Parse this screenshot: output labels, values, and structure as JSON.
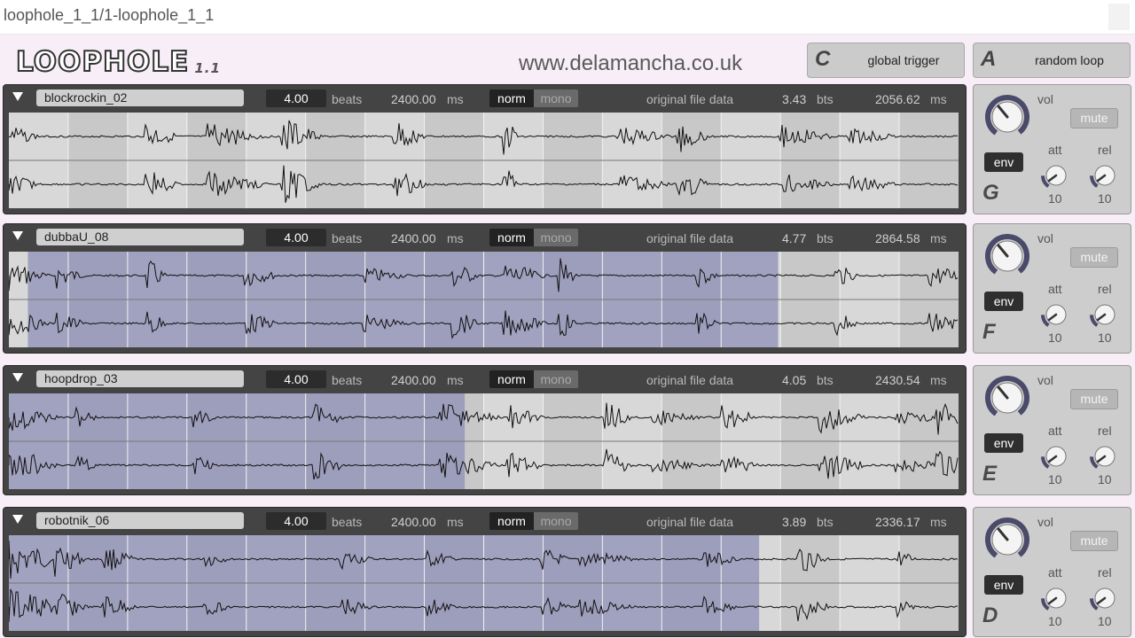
{
  "window": {
    "title": "loophole_1_1/1-loophole_1_1"
  },
  "app": {
    "logo": "LOOPHOLE",
    "version": "1.1",
    "website": "www.delamancha.co.uk"
  },
  "top_buttons": [
    {
      "key": "C",
      "label": "global trigger"
    },
    {
      "key": "A",
      "label": "random loop"
    }
  ],
  "labels": {
    "beats": "beats",
    "ms": "ms",
    "norm": "norm",
    "mono": "mono",
    "original": "original file data",
    "bts": "bts",
    "vol": "vol",
    "mute": "mute",
    "env": "env",
    "att": "att",
    "rel": "rel"
  },
  "colors": {
    "selection": "#8f8fb8",
    "panel": "#444444",
    "waveform": "#111111"
  },
  "tracks": [
    {
      "name": "blockrockin_02",
      "beats": "4.00",
      "duration": "2400.00",
      "orig_beats": "3.43",
      "orig_ms": "2056.62",
      "key": "G",
      "att": "10",
      "rel": "10",
      "selection_start": 0.0,
      "selection_end": 0.0,
      "seed": 3
    },
    {
      "name": "dubbaU_08",
      "beats": "4.00",
      "duration": "2400.00",
      "orig_beats": "4.77",
      "orig_ms": "2864.58",
      "key": "F",
      "att": "10",
      "rel": "10",
      "selection_start": 0.02,
      "selection_end": 0.81,
      "seed": 7
    },
    {
      "name": "hoopdrop_03",
      "beats": "4.00",
      "duration": "2400.00",
      "orig_beats": "4.05",
      "orig_ms": "2430.54",
      "key": "E",
      "att": "10",
      "rel": "10",
      "selection_start": 0.0,
      "selection_end": 0.48,
      "seed": 11
    },
    {
      "name": "robotnik_06",
      "beats": "4.00",
      "duration": "2400.00",
      "orig_beats": "3.89",
      "orig_ms": "2336.17",
      "key": "D",
      "att": "10",
      "rel": "10",
      "selection_start": 0.0,
      "selection_end": 0.79,
      "seed": 17
    }
  ]
}
